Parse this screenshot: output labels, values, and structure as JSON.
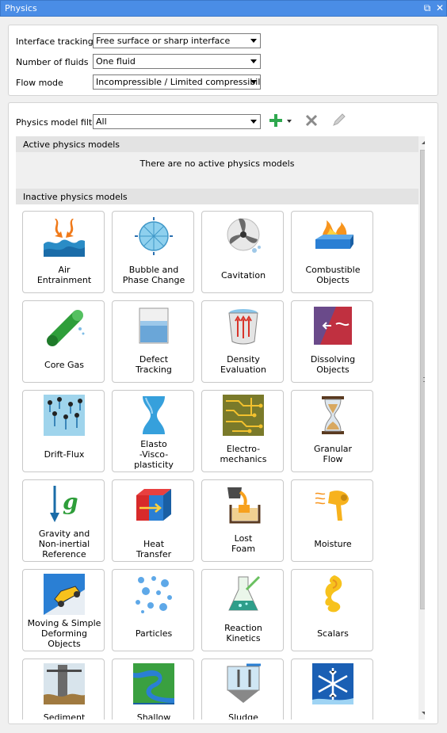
{
  "window": {
    "title": "Physics",
    "restore_icon": "restore-icon",
    "close_icon": "close-icon"
  },
  "settings": {
    "interface_tracking": {
      "label": "Interface tracking",
      "value": "Free surface or sharp interface"
    },
    "number_of_fluids": {
      "label": "Number of fluids",
      "value": "One fluid"
    },
    "flow_mode": {
      "label": "Flow mode",
      "value": "Incompressible / Limited compressibility"
    }
  },
  "filter": {
    "label": "Physics model filter",
    "value": "All"
  },
  "toolbar": {
    "add_icon": "plus-icon",
    "remove_icon": "x-icon",
    "edit_icon": "pencil-icon"
  },
  "active": {
    "header": "Active physics models",
    "empty_message": "There are no active physics models"
  },
  "inactive": {
    "header": "Inactive physics models",
    "models": [
      {
        "label": "Air\nEntrainment",
        "icon": "air-entrainment-icon"
      },
      {
        "label": "Bubble and\nPhase Change",
        "icon": "bubble-icon"
      },
      {
        "label": "Cavitation",
        "icon": "propeller-icon"
      },
      {
        "label": "Combustible\nObjects",
        "icon": "flame-icon"
      },
      {
        "label": "Core Gas",
        "icon": "core-gas-icon"
      },
      {
        "label": "Defect\nTracking",
        "icon": "beaker-icon"
      },
      {
        "label": "Density\nEvaluation",
        "icon": "pot-icon"
      },
      {
        "label": "Dissolving\nObjects",
        "icon": "dissolving-icon"
      },
      {
        "label": "Drift-Flux",
        "icon": "drift-flux-icon"
      },
      {
        "label": "Elasto\n-Visco-\nplasticity",
        "icon": "elasto-icon"
      },
      {
        "label": "Electro-\nmechanics",
        "icon": "circuit-icon"
      },
      {
        "label": "Granular\nFlow",
        "icon": "hourglass-icon"
      },
      {
        "label": "Gravity and\nNon-inertial\nReference",
        "icon": "gravity-icon"
      },
      {
        "label": "Heat\nTransfer",
        "icon": "heat-icon"
      },
      {
        "label": "Lost\nFoam",
        "icon": "ladle-icon"
      },
      {
        "label": "Moisture",
        "icon": "hairdryer-icon"
      },
      {
        "label": "Moving & Simple\nDeforming\nObjects",
        "icon": "car-icon"
      },
      {
        "label": "Particles",
        "icon": "particles-icon"
      },
      {
        "label": "Reaction\nKinetics",
        "icon": "flask-icon"
      },
      {
        "label": "Scalars",
        "icon": "swirl-icon"
      },
      {
        "label": "Sediment",
        "icon": "sediment-icon"
      },
      {
        "label": "Shallow",
        "icon": "river-icon"
      },
      {
        "label": "Sludge",
        "icon": "sludge-icon"
      },
      {
        "label": "",
        "icon": "snowflake-icon"
      }
    ]
  }
}
